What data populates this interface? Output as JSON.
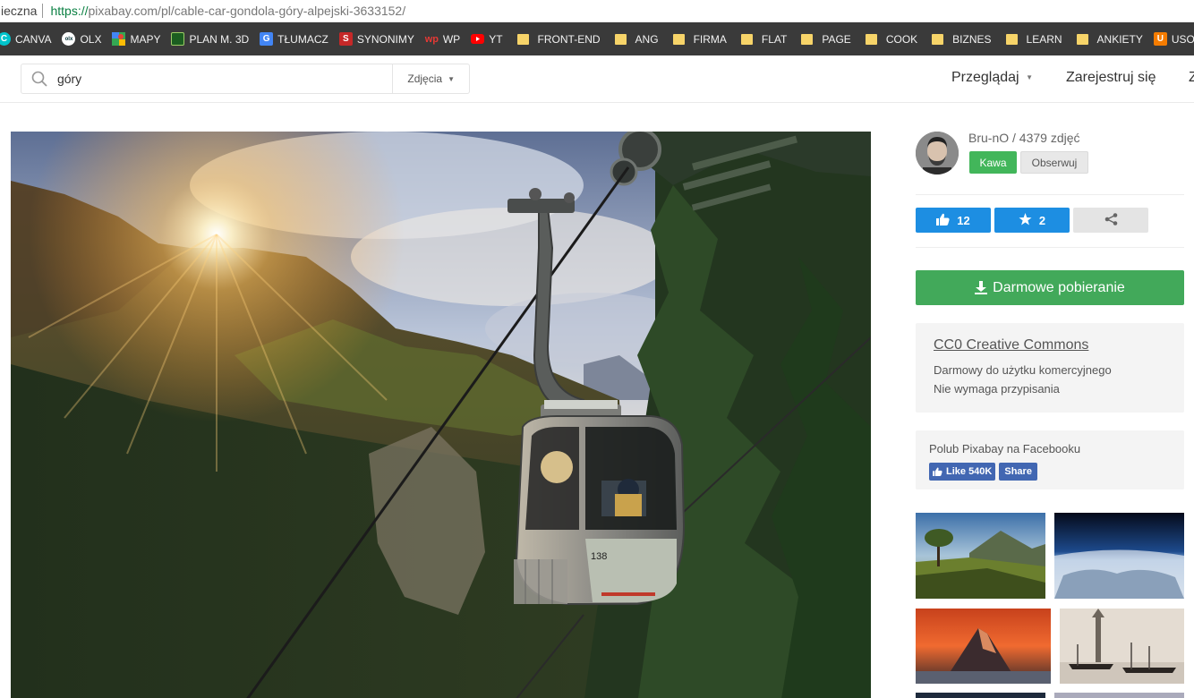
{
  "browser": {
    "secure_label": "ieczna",
    "url_scheme": "https://",
    "url_host_path": "pixabay.com/pl/cable-car-gondola-góry-alpejski-3633152/"
  },
  "bookmarks": [
    {
      "label": "CANVA",
      "icon": "canva-icon",
      "color": "#00c4cc"
    },
    {
      "label": "OLX",
      "icon": "olx-icon",
      "color": "#ffffff"
    },
    {
      "label": "MAPY",
      "icon": "maps-icon",
      "color": "#34a853"
    },
    {
      "label": "PLAN M. 3D",
      "icon": "plan-icon",
      "color": "#2e7d32"
    },
    {
      "label": "TŁUMACZ",
      "icon": "translate-icon",
      "color": "#4285f4"
    },
    {
      "label": "SYNONIMY",
      "icon": "synonimy-icon",
      "color": "#d32f2f"
    },
    {
      "label": "WP",
      "icon": "wp-icon",
      "color": "#e53935"
    },
    {
      "label": "YT",
      "icon": "youtube-icon",
      "color": "#ff0000"
    },
    {
      "label": "FRONT-END",
      "icon": "folder-icon"
    },
    {
      "label": "ANG",
      "icon": "folder-icon"
    },
    {
      "label": "FIRMA",
      "icon": "folder-icon"
    },
    {
      "label": "FLAT",
      "icon": "folder-icon"
    },
    {
      "label": "PAGE",
      "icon": "folder-icon"
    },
    {
      "label": "COOK",
      "icon": "folder-icon"
    },
    {
      "label": "BIZNES",
      "icon": "folder-icon"
    },
    {
      "label": "LEARN",
      "icon": "folder-icon"
    },
    {
      "label": "ANKIETY",
      "icon": "folder-icon"
    },
    {
      "label": "USOS",
      "icon": "usos-icon",
      "color": "#f57c00"
    }
  ],
  "header": {
    "search_value": "góry",
    "search_type": "Zdjęcia",
    "nav_browse": "Przeglądaj",
    "nav_register": "Zarejestruj się",
    "nav_cut": "Z"
  },
  "photo": {
    "gondola_number": "138"
  },
  "sidebar": {
    "author": "Bru-nO / 4379 zdjęć",
    "coffee_label": "Kawa",
    "follow_label": "Obserwuj",
    "likes": "12",
    "favorites": "2",
    "download_label": "Darmowe pobieranie",
    "license_title": "CC0 Creative Commons",
    "license_line1": "Darmowy do użytku komercyjnego",
    "license_line2": "Nie wymaga przypisania",
    "fb_label": "Polub Pixabay na Facebooku",
    "fb_like": "Like 540K",
    "fb_share": "Share"
  },
  "colors": {
    "accent_blue": "#1d8ee2",
    "download_green": "#42a95a",
    "coffee_green": "#42b65a",
    "facebook_blue": "#4267b2"
  }
}
